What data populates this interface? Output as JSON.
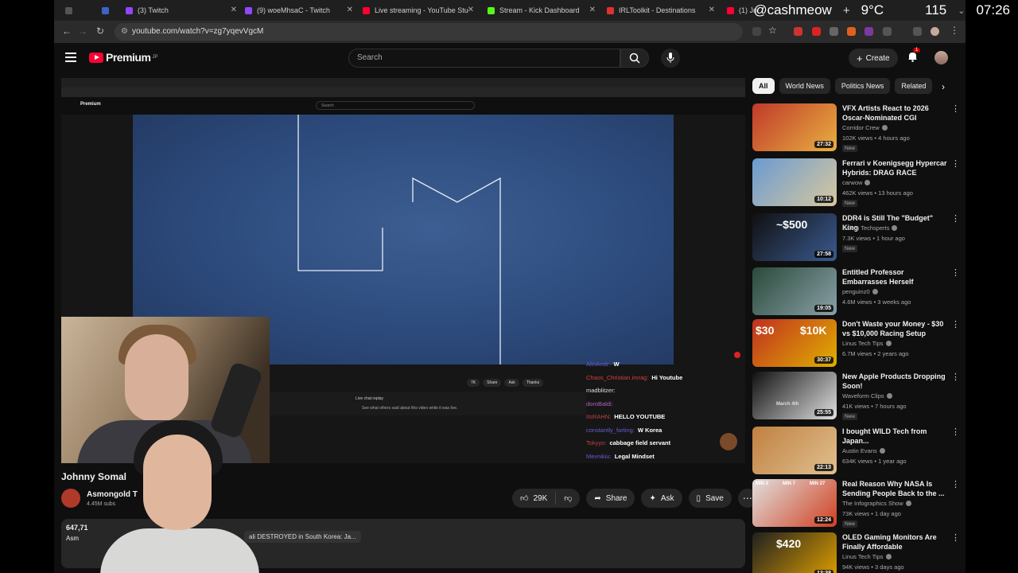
{
  "tabs": [
    {
      "title": "",
      "color": "#3d63c9"
    },
    {
      "title": "(3) Twitch",
      "color": "#9146ff"
    },
    {
      "title": "(9) woeMhsaC - Twitch",
      "color": "#9146ff"
    },
    {
      "title": "Live streaming - YouTube Stu",
      "color": "#ff0033"
    },
    {
      "title": "Stream - Kick Dashboard",
      "color": "#53fc18"
    },
    {
      "title": "IRLToolkit - Destinations",
      "color": "#e03030"
    },
    {
      "title": "(1) Jo",
      "color": "#ff0033"
    }
  ],
  "overlay": {
    "handle": "@cashmeow",
    "temp": "9°C",
    "count": "115",
    "time": "07:26"
  },
  "address": {
    "url": "youtube.com/watch?v=zg7yqevVgcM"
  },
  "yt": {
    "logo": "Premium",
    "region": "JP",
    "search_placeholder": "Search",
    "create": "Create",
    "notif_count": "1"
  },
  "nested": {
    "logo": "Premium",
    "search": "Search",
    "live_chat_replay": "Live chat replay",
    "see_what": "See what others said about this video while it was live.",
    "btns": [
      "7K",
      "Share",
      "Ask",
      "Thanks"
    ]
  },
  "chat": [
    {
      "user": "AlinAndr:",
      "msg": "W"
    },
    {
      "user": "Chaos_Christian.imrag:",
      "msg": "Hi Youtube"
    },
    {
      "user": "madblitzer:",
      "msg": ""
    },
    {
      "user": "doroBaldi:",
      "msg": ""
    },
    {
      "user": "ItsRAHN:",
      "msg": "HELLO YOUTUBE"
    },
    {
      "user": "constantly_farting:",
      "msg": "W Korea"
    },
    {
      "user": "Tokyyo:",
      "msg": "cabbage field servant"
    },
    {
      "user": "Mevnikiu:",
      "msg": "Legal Mindset"
    }
  ],
  "video": {
    "title": "Johnny Somal",
    "channel": "Asmongold T",
    "subs": "4.45M subs",
    "likes": "29K",
    "share": "Share",
    "ask": "Ask",
    "save": "Save",
    "views": "647,71",
    "desc_prefix": "Asm",
    "related_title": "ali DESTROYED in South Korea: Ja..."
  },
  "chips": [
    "All",
    "World News",
    "Politics News",
    "Related"
  ],
  "recs": [
    {
      "title": "VFX Artists React to 2026 Oscar-Nominated CGI",
      "channel": "Corridor Crew",
      "meta": "102K views • 4 hours ago",
      "new": "New",
      "dur": "27:32",
      "c1": "#c0392b",
      "c2": "#e8b040"
    },
    {
      "title": "Ferrari v Koenigsegg Hypercar Hybrids: DRAG RACE",
      "channel": "carwow",
      "meta": "462K views • 13 hours ago",
      "new": "New",
      "dur": "10:12",
      "c1": "#6a9ad0",
      "c2": "#d8c8a0"
    },
    {
      "title": "DDR4 is Still The \"Budget\" King",
      "channel": "Salem Techsperts",
      "meta": "7.3K views • 1 hour ago",
      "new": "New",
      "dur": "27:58",
      "c1": "#101010",
      "c2": "#3a5a90"
    },
    {
      "title": "Entitled Professor Embarrasses Herself",
      "channel": "penguinz0",
      "meta": "4.6M views • 3 weeks ago",
      "new": "",
      "dur": "19:05",
      "c1": "#2a4a3a",
      "c2": "#8aa0a8"
    },
    {
      "title": "Don't Waste your Money - $30 vs $10,000 Racing Setup",
      "channel": "Linus Tech Tips",
      "meta": "6.7M views • 2 years ago",
      "new": "",
      "dur": "30:37",
      "c1": "#c03020",
      "c2": "#e0b000"
    },
    {
      "title": "New Apple Products Dropping Soon!",
      "channel": "Waveform Clips",
      "meta": "41K views • 7 hours ago",
      "new": "New",
      "dur": "25:55",
      "c1": "#101010",
      "c2": "#e0e0e0"
    },
    {
      "title": "I bought WILD Tech from Japan...",
      "channel": "Austin Evans",
      "meta": "634K views • 1 year ago",
      "new": "",
      "dur": "22:13",
      "c1": "#c08040",
      "c2": "#e0c090"
    },
    {
      "title": "Real Reason Why NASA Is Sending People Back to the ...",
      "channel": "The Infographics Show",
      "meta": "73K views • 1 day ago",
      "new": "New",
      "dur": "12:24",
      "c1": "#e0e0e0",
      "c2": "#d04020"
    },
    {
      "title": "OLED Gaming Monitors Are Finally Affordable",
      "channel": "Linus Tech Tips",
      "meta": "94K views • 3 days ago",
      "new": "",
      "dur": "13:38",
      "c1": "#202020",
      "c2": "#e0a000"
    }
  ],
  "thumb_labels": {
    "ddr4": "~$500",
    "racing1": "$30",
    "racing2": "$10K",
    "oled": "$420",
    "apple": "March 4th",
    "nasa1": "MIN 3",
    "nasa2": "MIN 7",
    "nasa3": "MIN 27"
  }
}
